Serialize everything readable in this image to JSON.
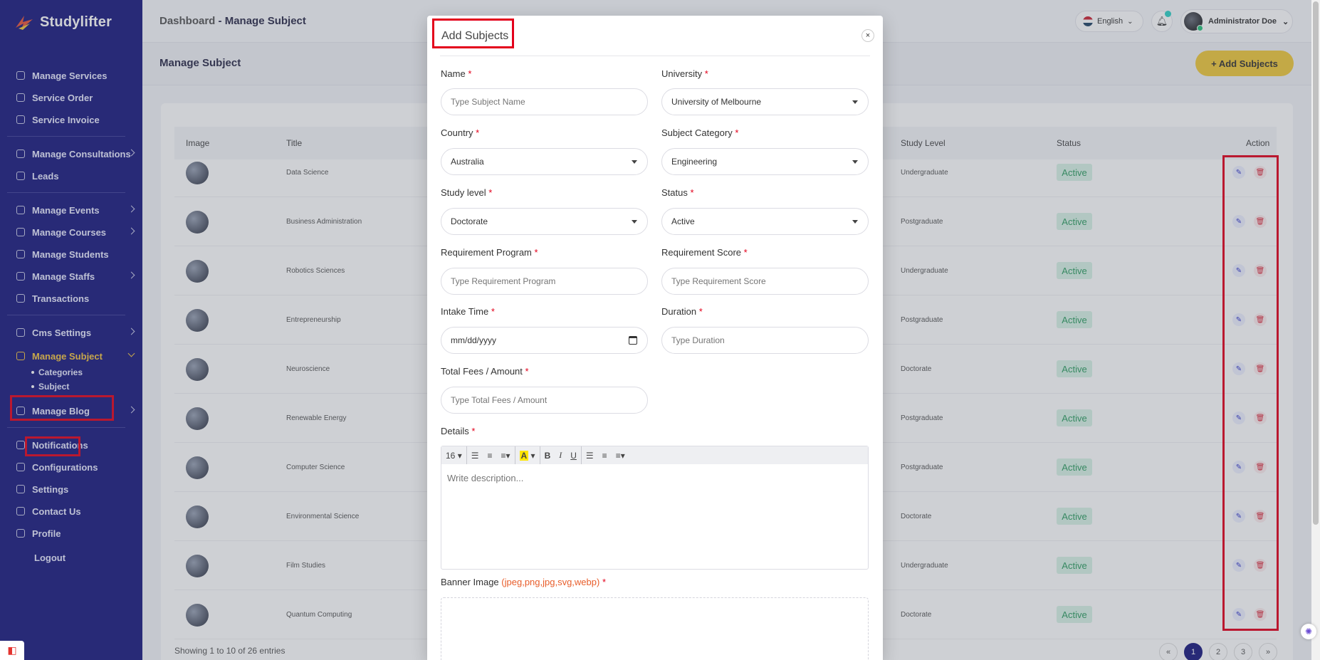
{
  "brand": {
    "name": "Studylifter"
  },
  "sidebar": {
    "items": [
      {
        "label": "Manage Services",
        "icon": "services-icon"
      },
      {
        "label": "Service Order",
        "icon": "order-icon"
      },
      {
        "label": "Service Invoice",
        "icon": "invoice-icon"
      },
      {
        "label": "Manage Consultations",
        "icon": "consultation-icon"
      },
      {
        "label": "Leads",
        "icon": "leads-icon"
      },
      {
        "label": "Manage Events",
        "icon": "calendar-icon"
      },
      {
        "label": "Manage Courses",
        "icon": "course-icon"
      },
      {
        "label": "Manage Students",
        "icon": "student-icon"
      },
      {
        "label": "Manage Staffs",
        "icon": "staff-icon"
      },
      {
        "label": "Transactions",
        "icon": "transaction-icon"
      },
      {
        "label": "Cms Settings",
        "icon": "cms-icon"
      },
      {
        "label": "Manage Subject",
        "icon": "book-icon"
      },
      {
        "label": "Manage Blog",
        "icon": "blog-icon"
      },
      {
        "label": "Notifications",
        "icon": "bell-icon"
      },
      {
        "label": "Configurations",
        "icon": "config-icon"
      },
      {
        "label": "Settings",
        "icon": "gear-icon"
      },
      {
        "label": "Contact Us",
        "icon": "contact-icon"
      },
      {
        "label": "Profile",
        "icon": "user-icon"
      },
      {
        "label": "Logout",
        "icon": "logout-icon"
      }
    ],
    "subitems": [
      "Categories",
      "Subject"
    ]
  },
  "topbar": {
    "breadcrumb_root": "Dashboard",
    "breadcrumb_sep": "-",
    "breadcrumb_current": "Manage Subject",
    "language": "English",
    "user_name": "Administrator Doe"
  },
  "page": {
    "title": "Manage Subject",
    "add_button": "+ Add Subjects"
  },
  "table": {
    "headers": {
      "image": "Image",
      "title": "Title",
      "study_level": "Study Level",
      "status": "Status",
      "action": "Action"
    },
    "rows": [
      {
        "title": "Data Science",
        "level": "Undergraduate",
        "status": "Active"
      },
      {
        "title": "Business Administration",
        "level": "Postgraduate",
        "status": "Active"
      },
      {
        "title": "Robotics Sciences",
        "level": "Undergraduate",
        "status": "Active"
      },
      {
        "title": "Entrepreneurship",
        "level": "Postgraduate",
        "status": "Active"
      },
      {
        "title": "Neuroscience",
        "level": "Doctorate",
        "status": "Active"
      },
      {
        "title": "Renewable Energy",
        "level": "Postgraduate",
        "status": "Active"
      },
      {
        "title": "Computer Science",
        "level": "Postgraduate",
        "status": "Active"
      },
      {
        "title": "Environmental Science",
        "level": "Doctorate",
        "status": "Active"
      },
      {
        "title": "Film Studies",
        "level": "Undergraduate",
        "status": "Active"
      },
      {
        "title": "Quantum Computing",
        "level": "Doctorate",
        "status": "Active"
      }
    ],
    "footer": "Showing 1 to 10 of 26 entries",
    "pagination": [
      "«",
      "1",
      "2",
      "3",
      "»"
    ]
  },
  "modal": {
    "title": "Add Subjects",
    "close": "×",
    "fields": {
      "name": {
        "label": "Name",
        "placeholder": "Type Subject Name"
      },
      "university": {
        "label": "University",
        "value": "University of Melbourne"
      },
      "country": {
        "label": "Country",
        "value": "Australia"
      },
      "category": {
        "label": "Subject Category",
        "value": "Engineering"
      },
      "study_level": {
        "label": "Study level",
        "value": "Doctorate"
      },
      "status": {
        "label": "Status",
        "value": "Active"
      },
      "req_program": {
        "label": "Requirement Program",
        "placeholder": "Type Requirement Program"
      },
      "req_score": {
        "label": "Requirement Score",
        "placeholder": "Type Requirement Score"
      },
      "intake": {
        "label": "Intake Time",
        "placeholder": "mm/dd/yyyy"
      },
      "duration": {
        "label": "Duration",
        "placeholder": "Type Duration"
      },
      "fees": {
        "label": "Total Fees / Amount",
        "placeholder": "Type Total Fees / Amount"
      },
      "details": {
        "label": "Details",
        "placeholder": "Write description..."
      },
      "banner": {
        "label": "Banner Image",
        "hint": "(jpeg,png,jpg,svg,webp)"
      }
    },
    "required_mark": "*",
    "toolbar": {
      "font_size": "16",
      "bold": "B",
      "italic": "I",
      "underline": "U",
      "color": "A"
    }
  },
  "colors": {
    "sidebar_bg": "#1a1a7e",
    "accent": "#f0c93b",
    "active_badge": "#2e9d62",
    "highlight_box": "#e3001b"
  }
}
